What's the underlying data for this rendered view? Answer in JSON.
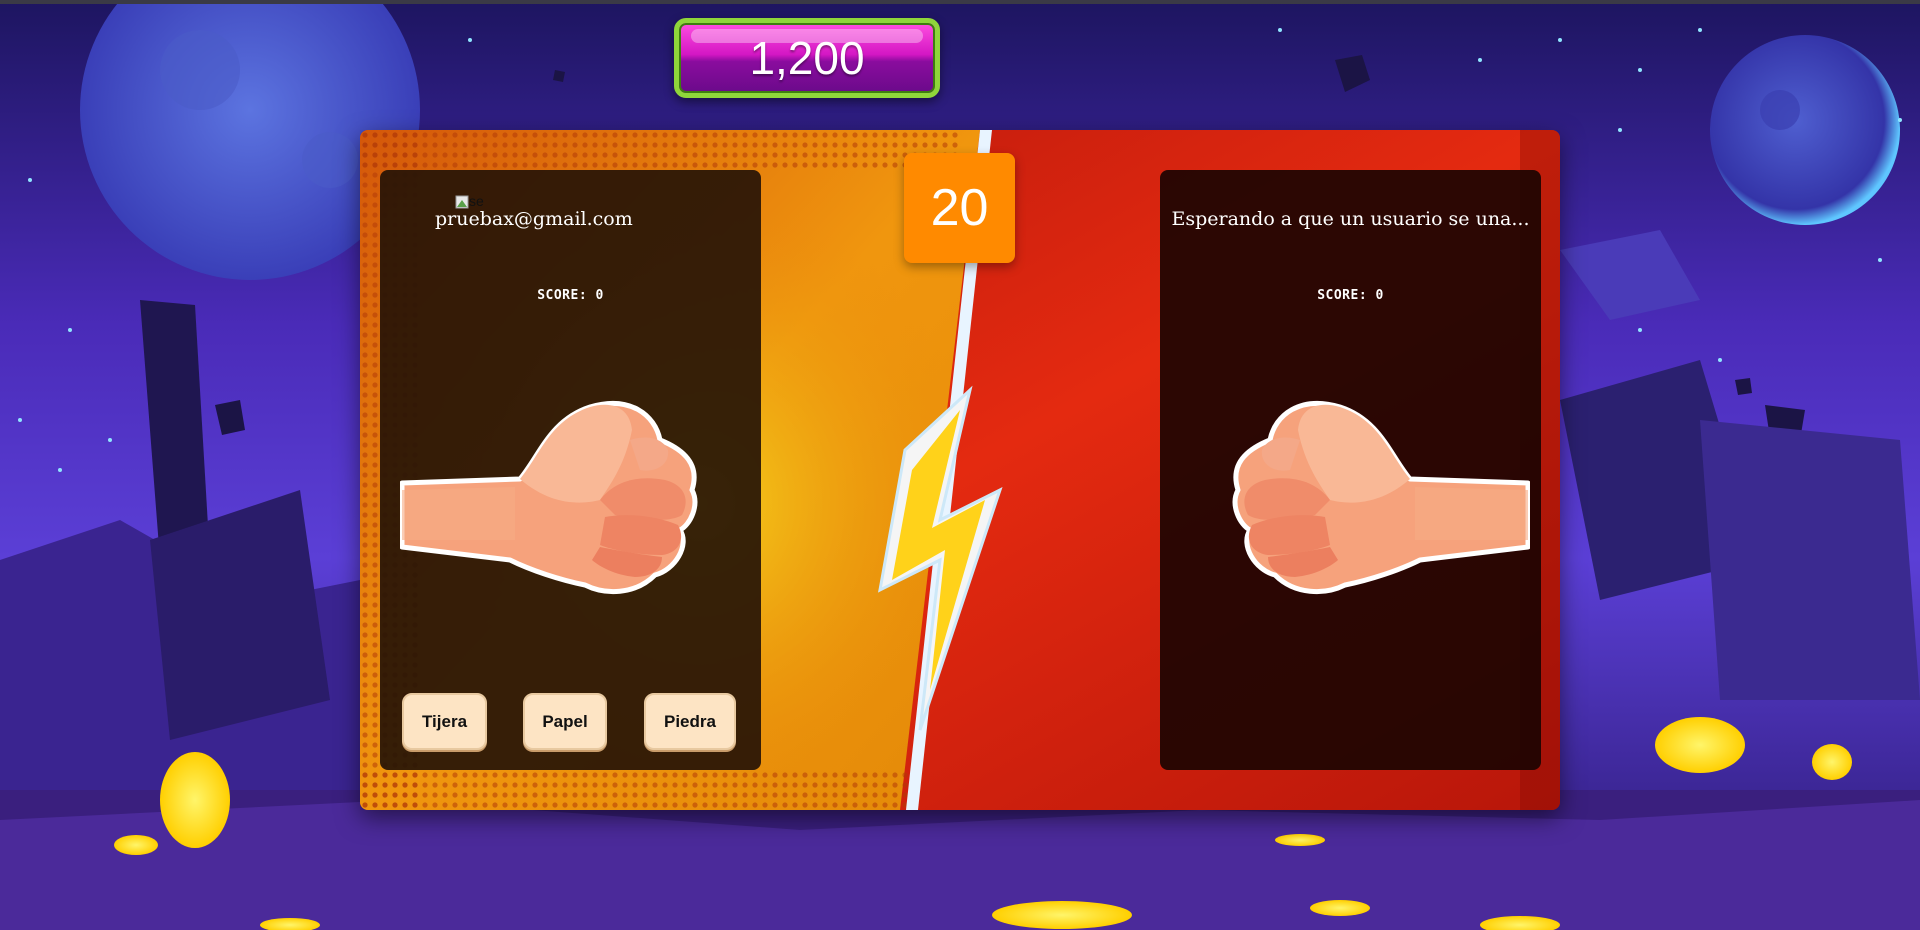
{
  "header": {
    "coins": "1,200"
  },
  "timer": {
    "seconds": "20"
  },
  "player_left": {
    "name": "pruebax@gmail.com",
    "avatar_alt": "se",
    "score_label": "SCORE: 0",
    "hand": "fist-icon"
  },
  "player_right": {
    "status": "Esperando a que un usuario se una...",
    "score_label": "SCORE: 0",
    "hand": "fist-icon"
  },
  "choices": [
    {
      "label": "Tijera"
    },
    {
      "label": "Papel"
    },
    {
      "label": "Piedra"
    }
  ],
  "colors": {
    "timer": "#ff8a00",
    "choice_button": "#fde4c4",
    "coin_counter": "#d417c4",
    "coin_border": "#8fd63a"
  }
}
